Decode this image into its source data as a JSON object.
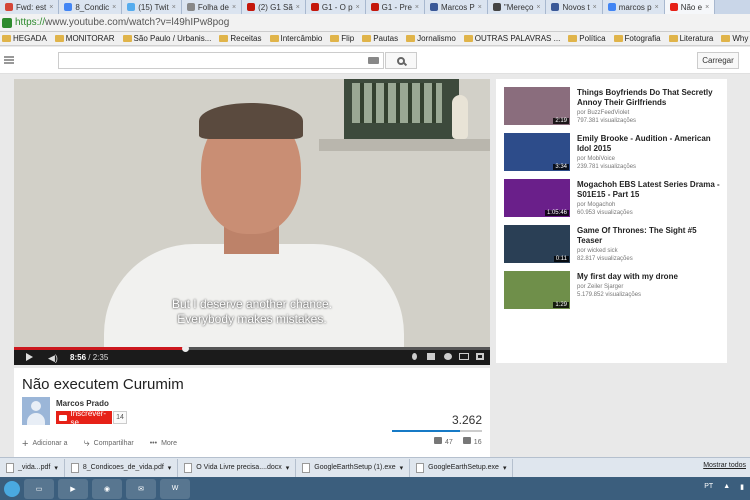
{
  "browser": {
    "tabs": [
      {
        "label": "Fwd: est",
        "color": "#d44638"
      },
      {
        "label": "8_Condic",
        "color": "#4285f4"
      },
      {
        "label": "(15) Twit",
        "color": "#55acee"
      },
      {
        "label": "Folha de",
        "color": "#888888"
      },
      {
        "label": "(2) G1 Sã",
        "color": "#c4170c"
      },
      {
        "label": "G1 - O p",
        "color": "#c4170c"
      },
      {
        "label": "G1 - Pre",
        "color": "#c4170c"
      },
      {
        "label": "Marcos P",
        "color": "#3b5998"
      },
      {
        "label": "\"Mereço",
        "color": "#444444"
      },
      {
        "label": "Novos t",
        "color": "#3b5998"
      },
      {
        "label": "marcos p",
        "color": "#4285f4"
      },
      {
        "label": "Não e",
        "color": "#e62117"
      }
    ],
    "url_scheme": "https://",
    "url_rest": "www.youtube.com/watch?v=l49hIPw8pog",
    "bookmarks": [
      "HEGADA",
      "MONITORAR",
      "São Paulo / Urbanis...",
      "Receitas",
      "Intercâmbio",
      "Flip",
      "Pautas",
      "Jornalismo",
      "OUTRAS PALAVRAS ...",
      "Política",
      "Fotografia",
      "Literatura",
      "Why Are Brazilians P...",
      "F/STYLE PARIS | STYL..."
    ]
  },
  "youtube": {
    "upload_label": "Carregar"
  },
  "player": {
    "subtitle_line1": "But I deserve another chance.",
    "subtitle_line2": "Everybody makes mistakes.",
    "current_time": "8:56",
    "duration": "/ 2:35",
    "progress_fraction": 0.36
  },
  "video": {
    "title": "Não executem Curumim",
    "channel": "Marcos Prado",
    "subscribe_label": "Inscrever-se",
    "subscriber_count": "14",
    "view_count": "3.262",
    "like_fraction": 0.75,
    "actions": {
      "add_to": "Adicionar a",
      "share": "Compartilhar",
      "more": "More"
    },
    "likes": "47",
    "dislikes": "16"
  },
  "recommended": [
    {
      "title": "Things Boyfriends Do That Secretly Annoy Their Girlfriends",
      "channel": "por BuzzFeedViolet",
      "views": "797.381 visualizações",
      "duration": "2:19",
      "thumb": "#8a6d7d"
    },
    {
      "title": "Emily Brooke - Audition - American Idol 2015",
      "channel": "por MobiVoice",
      "views": "239.781 visualizações",
      "duration": "3:34",
      "thumb": "#2d4c8a"
    },
    {
      "title": "Mogachoh EBS Latest Series Drama - S01E15 - Part 15",
      "channel": "por Mogachoh",
      "views": "60.953 visualizações",
      "duration": "1:05:46",
      "thumb": "#6a1f8a"
    },
    {
      "title": "Game Of Thrones: The Sight #5 Teaser",
      "channel": "por wicked sick",
      "views": "82.817 visualizações",
      "duration": "0:11",
      "thumb": "#2a3f55"
    },
    {
      "title": "My first day with my drone",
      "channel": "por Zeiler Sjarger",
      "views": "5.179.852 visualizações",
      "duration": "1:29",
      "thumb": "#6f8f4a"
    }
  ],
  "downloads": {
    "files": [
      "_vida...pdf",
      "8_Condicoes_de_vida.pdf",
      "O Vida Livre precisa....docx",
      "GoogleEarthSetup (1).exe",
      "GoogleEarthSetup.exe"
    ],
    "show_all": "Mostrar todos"
  },
  "taskbar": {
    "lang": "PT"
  }
}
